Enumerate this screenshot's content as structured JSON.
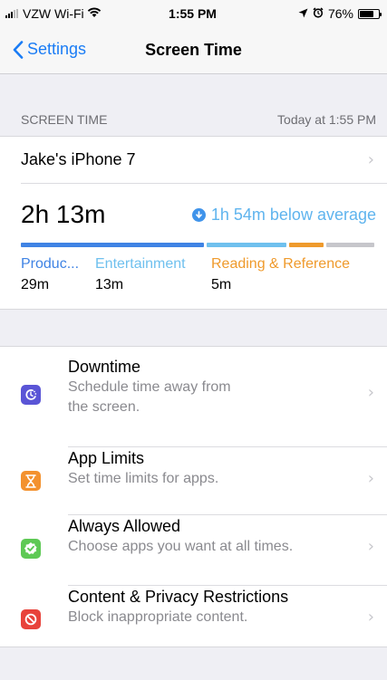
{
  "status_bar": {
    "carrier": "VZW Wi-Fi",
    "time": "1:55 PM",
    "battery": "76%",
    "battery_level": 0.76
  },
  "nav": {
    "back_label": "Settings",
    "title": "Screen Time"
  },
  "summary": {
    "section_label": "SCREEN TIME",
    "section_time": "Today at 1:55 PM",
    "device_name": "Jake's iPhone 7",
    "total_time": "2h 13m",
    "average_text": "1h 54m below average",
    "categories": [
      {
        "name": "Produc...",
        "time": "29m",
        "color": "#3f83e4"
      },
      {
        "name": "Entertainment",
        "time": "13m",
        "color": "#6fc0ee"
      },
      {
        "name": "Reading & Reference",
        "time": "5m",
        "color": "#ef9a2c"
      }
    ],
    "other_color": "#c6c6cb"
  },
  "menu": {
    "items": [
      {
        "title": "Downtime",
        "subtitle_lines": [
          "Schedule time away from",
          "the screen."
        ],
        "icon": "downtime-icon",
        "color": "#5a55d6"
      },
      {
        "title": "App Limits",
        "subtitle_lines": [
          "Set time limits for apps."
        ],
        "icon": "hourglass-icon",
        "color": "#f3912e"
      },
      {
        "title": "Always Allowed",
        "subtitle_lines": [
          "Choose apps you want at all times."
        ],
        "icon": "checkmark-badge-icon",
        "color": "#5ec955"
      },
      {
        "title": "Content & Privacy Restrictions",
        "subtitle_lines": [
          "Block inappropriate content."
        ],
        "icon": "block-icon",
        "color": "#e8433b"
      }
    ]
  }
}
